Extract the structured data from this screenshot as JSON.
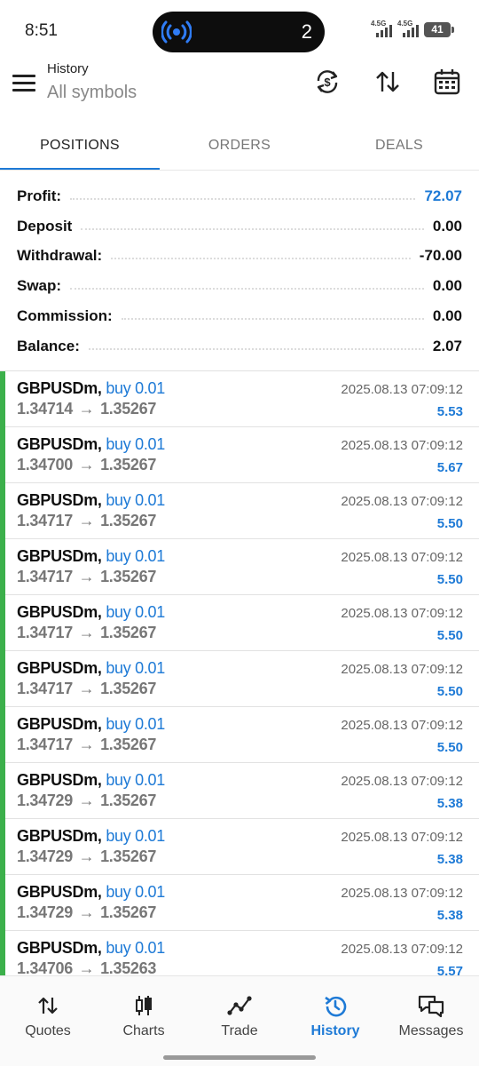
{
  "status_bar": {
    "time": "8:51",
    "island_count": "2",
    "signal1_label": "4.5G",
    "signal2_label": "4.5G",
    "battery": "41"
  },
  "app_bar": {
    "title": "History",
    "subtitle": "All symbols",
    "icons": [
      "currency-sync-icon",
      "sort-icon",
      "calendar-icon"
    ]
  },
  "tabs": [
    {
      "label": "POSITIONS",
      "active": true
    },
    {
      "label": "ORDERS",
      "active": false
    },
    {
      "label": "DEALS",
      "active": false
    }
  ],
  "summary": [
    {
      "label": "Profit:",
      "value": "72.07",
      "highlight": true
    },
    {
      "label": "Deposit",
      "value": "0.00",
      "highlight": false
    },
    {
      "label": "Withdrawal:",
      "value": "-70.00",
      "highlight": false
    },
    {
      "label": "Swap:",
      "value": "0.00",
      "highlight": false
    },
    {
      "label": "Commission:",
      "value": "0.00",
      "highlight": false
    },
    {
      "label": "Balance:",
      "value": "2.07",
      "highlight": false
    }
  ],
  "positions": [
    {
      "symbol": "GBPUSDm,",
      "type": "buy 0.01",
      "open": "1.34714",
      "close": "1.35267",
      "time": "2025.08.13 07:09:12",
      "profit": "5.53"
    },
    {
      "symbol": "GBPUSDm,",
      "type": "buy 0.01",
      "open": "1.34700",
      "close": "1.35267",
      "time": "2025.08.13 07:09:12",
      "profit": "5.67"
    },
    {
      "symbol": "GBPUSDm,",
      "type": "buy 0.01",
      "open": "1.34717",
      "close": "1.35267",
      "time": "2025.08.13 07:09:12",
      "profit": "5.50"
    },
    {
      "symbol": "GBPUSDm,",
      "type": "buy 0.01",
      "open": "1.34717",
      "close": "1.35267",
      "time": "2025.08.13 07:09:12",
      "profit": "5.50"
    },
    {
      "symbol": "GBPUSDm,",
      "type": "buy 0.01",
      "open": "1.34717",
      "close": "1.35267",
      "time": "2025.08.13 07:09:12",
      "profit": "5.50"
    },
    {
      "symbol": "GBPUSDm,",
      "type": "buy 0.01",
      "open": "1.34717",
      "close": "1.35267",
      "time": "2025.08.13 07:09:12",
      "profit": "5.50"
    },
    {
      "symbol": "GBPUSDm,",
      "type": "buy 0.01",
      "open": "1.34717",
      "close": "1.35267",
      "time": "2025.08.13 07:09:12",
      "profit": "5.50"
    },
    {
      "symbol": "GBPUSDm,",
      "type": "buy 0.01",
      "open": "1.34729",
      "close": "1.35267",
      "time": "2025.08.13 07:09:12",
      "profit": "5.38"
    },
    {
      "symbol": "GBPUSDm,",
      "type": "buy 0.01",
      "open": "1.34729",
      "close": "1.35267",
      "time": "2025.08.13 07:09:12",
      "profit": "5.38"
    },
    {
      "symbol": "GBPUSDm,",
      "type": "buy 0.01",
      "open": "1.34729",
      "close": "1.35267",
      "time": "2025.08.13 07:09:12",
      "profit": "5.38"
    },
    {
      "symbol": "GBPUSDm,",
      "type": "buy 0.01",
      "open": "1.34706",
      "close": "1.35263",
      "time": "2025.08.13 07:09:12",
      "profit": "5.57"
    }
  ],
  "arrow": "→",
  "bottom_nav": [
    {
      "label": "Quotes",
      "icon": "quotes-icon",
      "active": false
    },
    {
      "label": "Charts",
      "icon": "charts-icon",
      "active": false
    },
    {
      "label": "Trade",
      "icon": "trade-icon",
      "active": false
    },
    {
      "label": "History",
      "icon": "history-icon",
      "active": true
    },
    {
      "label": "Messages",
      "icon": "messages-icon",
      "active": false
    }
  ],
  "colors": {
    "accent": "#1e7ad6",
    "buy_bar": "#3cb04b",
    "text": "#111111",
    "muted": "#777777"
  }
}
